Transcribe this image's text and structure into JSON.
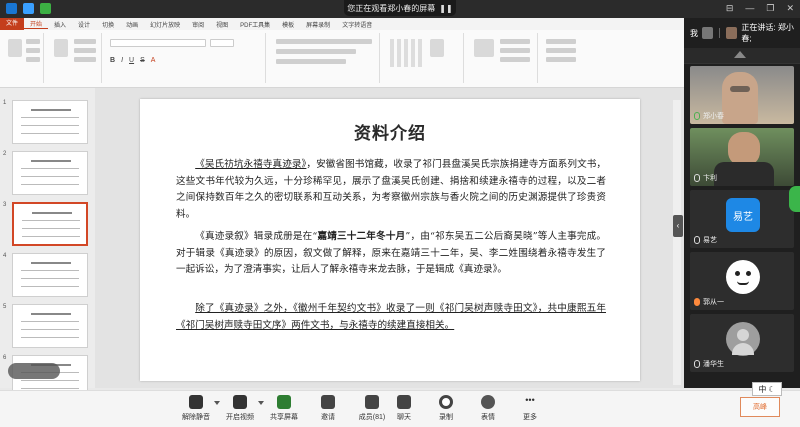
{
  "meeting": {
    "viewing_banner": "您正在观看郑小春的屏幕",
    "me_label": "我",
    "speaking_label": "正在讲话: 郑小春;",
    "participants": [
      {
        "name": "郑小春",
        "type": "video"
      },
      {
        "name": "卞利",
        "type": "video"
      },
      {
        "name": "易艺",
        "type": "avatar",
        "avatar_text": "易艺",
        "avatar_color": "#1e88e5"
      },
      {
        "name": "郭从一",
        "type": "avatar",
        "avatar_color": "#ffffff"
      },
      {
        "name": "潘华生",
        "type": "avatar",
        "avatar_color": "#9e9e9e"
      }
    ]
  },
  "ppt": {
    "tabs": [
      "文件",
      "开始",
      "插入",
      "设计",
      "切换",
      "动画",
      "幻灯片放映",
      "审阅",
      "视图",
      "PDF工具集",
      "模板",
      "屏幕录制",
      "文字转语音"
    ],
    "active_tab": "开始",
    "slide_count_visible": 6,
    "selected_slide": 3
  },
  "slide": {
    "title": "资料介绍",
    "p1_ul": "《吴氏祊坑永禧寺真迹录》",
    "p1_rest": "，安徽省图书馆藏，收录了祁门县盘溪吴氏宗族捐建寺方面系列文书，这些文书年代较为久远，十分珍稀罕见，展示了盘溪吴氏创建、捐捨和续建永禧寺的过程，以及二者之间保持数百年之久的密切联系和互动关系，为考察徽州宗族与香火院之间的历史渊源提供了珍贵资料。",
    "p2_a": "《真迹录叙》辑录成册是在“",
    "p2_b": "嘉靖三十二年冬十月",
    "p2_c": "”，由“祁东吴五二公后裔昊晓”等人主事完成。对于辑录《真迹录》的原因，叙文做了解释，原来在嘉靖三十二年，吴、李二姓围绕着永禧寺发生了一起诉讼，为了澄清事实，让后人了解永禧寺来龙去脉，于是辑成《真迹录》。",
    "p3": "除了《真迹录》之外，《徽州千年契约文书》收录了一则《祁门吴树声赎寺田文》，共中康熙五年《祁门吴树声赎寺田文序》两件文书，与永禧寺的续建直接相关。"
  },
  "toolbar": {
    "items": [
      {
        "label": "解除静音",
        "icon": "mic-muted-icon"
      },
      {
        "label": "开启视频",
        "icon": "camera-icon"
      },
      {
        "label": "共享屏幕",
        "icon": "share-screen-icon"
      },
      {
        "label": "邀请",
        "icon": "invite-icon"
      },
      {
        "label": "成员(81)",
        "icon": "members-icon"
      },
      {
        "label": "聊天",
        "icon": "chat-icon"
      },
      {
        "label": "录制",
        "icon": "record-icon"
      },
      {
        "label": "表情",
        "icon": "emoji-icon"
      },
      {
        "label": "更多",
        "icon": "more-icon"
      }
    ]
  },
  "ime": {
    "label": "中"
  },
  "stamp_text": "高峰"
}
